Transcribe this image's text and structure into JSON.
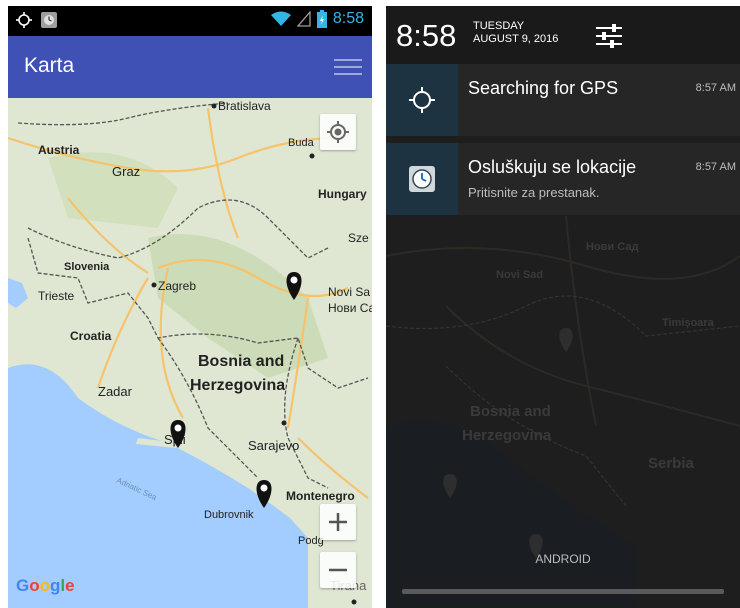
{
  "left_phone": {
    "status_bar": {
      "time": "8:58"
    },
    "app_bar": {
      "title": "Karta",
      "menu_icon": "hamburger-menu-icon"
    },
    "map": {
      "labels": {
        "bratislava": "Bratislava",
        "austria": "Austria",
        "graz": "Graz",
        "budapest": "Buda",
        "hungary": "Hungary",
        "szeged": "Sze",
        "slovenia": "Slovenia",
        "zagreb": "Zagreb",
        "trieste": "Trieste",
        "novi_sad": "Novi Sa",
        "novi_sad_cyr": "Нови Са",
        "croatia": "Croatia",
        "bosnia_line1": "Bosnia and",
        "bosnia_line2": "Herzegovina",
        "zadar": "Zadar",
        "split": "Spli",
        "sarajevo": "Sarajevo",
        "adriatic": "Adriatic Sea",
        "dubrovnik": "Dubrovnik",
        "montenegro": "Montenegro",
        "podgorica": "Podg",
        "tirana": "Tirana"
      },
      "marker_count": 3,
      "colors": {
        "land": "#dfe7d3",
        "sea": "#a3ccff",
        "road": "#f6c26a",
        "border": "#555555"
      },
      "logo": {
        "g1": "G",
        "o1": "o",
        "o2": "o",
        "g2": "g",
        "l": "l",
        "e": "e"
      }
    }
  },
  "right_phone": {
    "header": {
      "time": "8:58",
      "weekday": "TUESDAY",
      "date": "AUGUST 9, 2016",
      "settings_icon": "quick-settings-sliders-icon"
    },
    "notifications": [
      {
        "title": "Searching for GPS",
        "subtitle": "",
        "time": "8:57 AM",
        "icon": "gps-crosshair-icon"
      },
      {
        "title": "Osluškuju se lokacije",
        "subtitle": "Pritisnite za prestanak.",
        "time": "8:57 AM",
        "icon": "app-clock-icon"
      }
    ],
    "background_map": {
      "labels": {
        "novi_sad": "Нови Сад",
        "novi_sad_lat": "Novi Sad",
        "bosnia_line1": "Bosnia and",
        "bosnia_line2": "Herzegovina",
        "serbia": "Serbia",
        "timisoara": "Timișoara"
      }
    },
    "carrier": "ANDROID",
    "accent": "#33b5e5"
  }
}
